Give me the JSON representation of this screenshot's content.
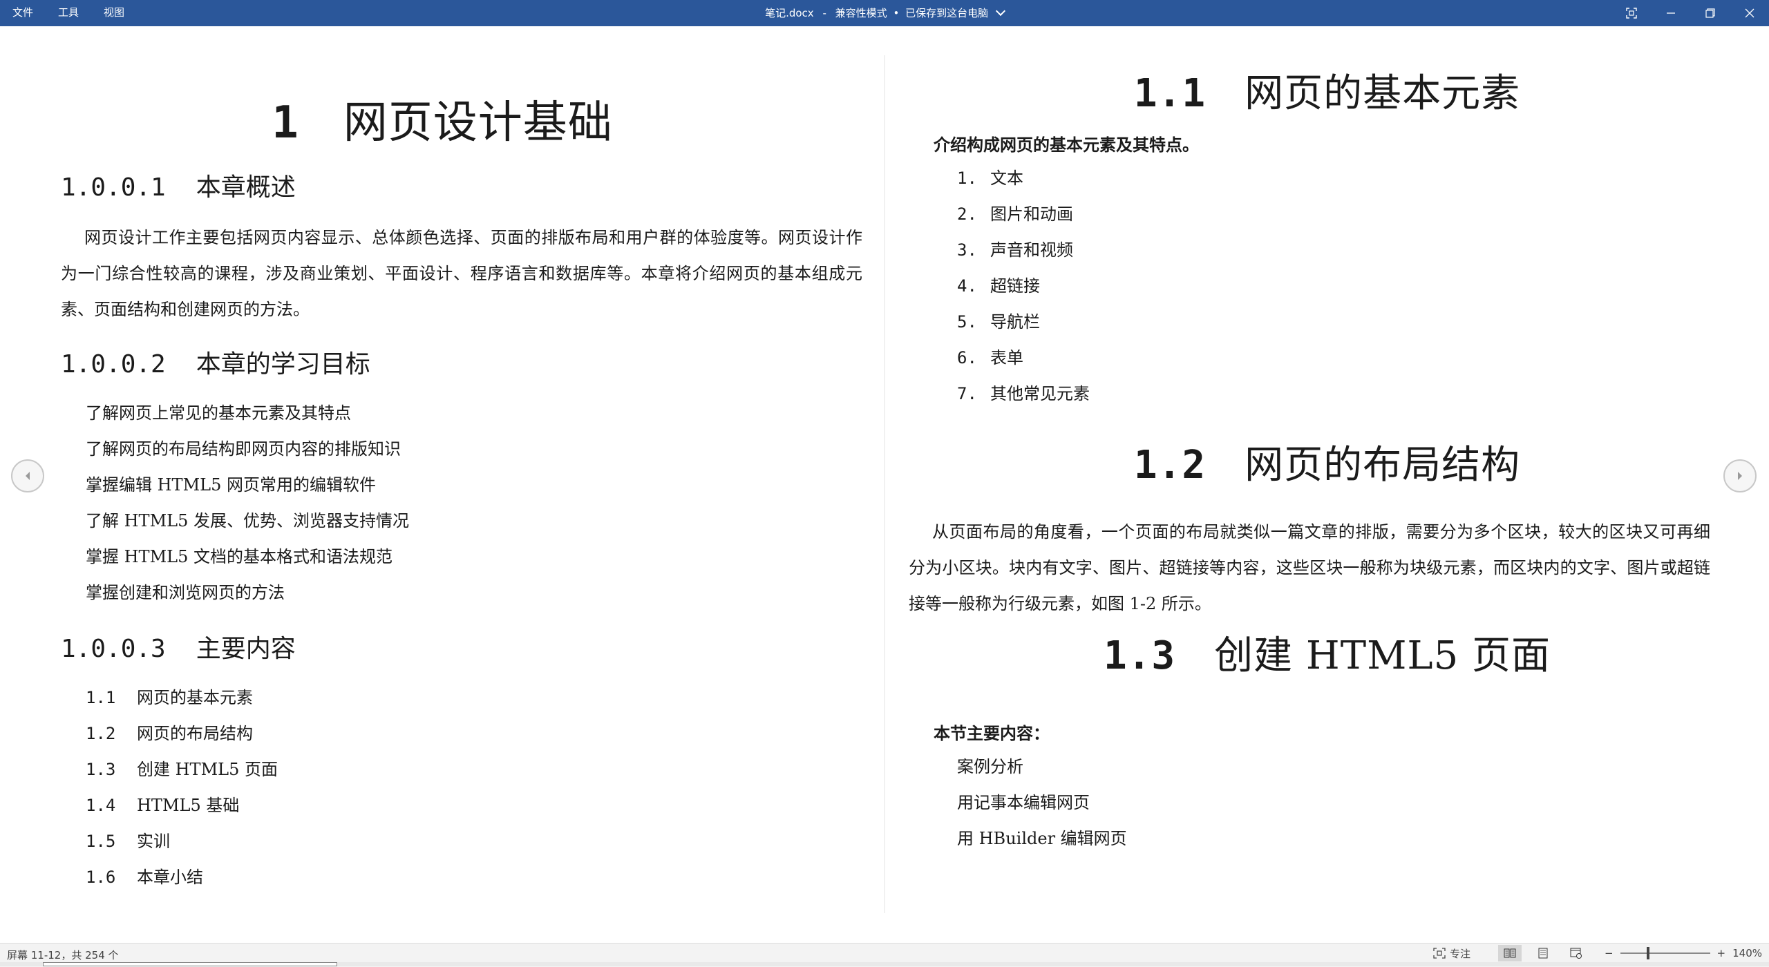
{
  "titlebar": {
    "menu": [
      "文件",
      "工具",
      "视图"
    ],
    "filename": "笔记.docx",
    "separator": "-",
    "mode": "兼容性模式",
    "dot": "•",
    "save_status": "已保存到这台电脑"
  },
  "left_page": {
    "chapter": {
      "num": "1",
      "title": "网页设计基础"
    },
    "sections": [
      {
        "num": "1.0.0.1",
        "title": "本章概述"
      },
      {
        "num": "1.0.0.2",
        "title": "本章的学习目标"
      },
      {
        "num": "1.0.0.3",
        "title": "主要内容"
      }
    ],
    "overview_paragraph": "网页设计工作主要包括网页内容显示、总体颜色选择、页面的排版布局和用户群的体验度等。网页设计作为一门综合性较高的课程，涉及商业策划、平面设计、程序语言和数据库等。本章将介绍网页的基本组成元素、页面结构和创建网页的方法。",
    "goals": [
      "了解网页上常见的基本元素及其特点",
      "了解网页的布局结构即网页内容的排版知识",
      "掌握编辑 HTML5 网页常用的编辑软件",
      "了解 HTML5 发展、优势、浏览器支持情况",
      "掌握 HTML5 文档的基本格式和语法规范",
      "掌握创建和浏览网页的方法"
    ],
    "toc": [
      {
        "num": "1.1",
        "title": "网页的基本元素"
      },
      {
        "num": "1.2",
        "title": "网页的布局结构"
      },
      {
        "num": "1.3",
        "title": "创建 HTML5 页面"
      },
      {
        "num": "1.4",
        "title": "HTML5 基础"
      },
      {
        "num": "1.5",
        "title": "实训"
      },
      {
        "num": "1.6",
        "title": "本章小结"
      }
    ]
  },
  "right_page": {
    "s11": {
      "num": "1.1",
      "title": "网页的基本元素"
    },
    "s11_intro": "介绍构成网页的基本元素及其特点。",
    "s11_items": [
      {
        "num": "1.",
        "text": "文本"
      },
      {
        "num": "2.",
        "text": "图片和动画"
      },
      {
        "num": "3.",
        "text": "声音和视频"
      },
      {
        "num": "4.",
        "text": "超链接"
      },
      {
        "num": "5.",
        "text": "导航栏"
      },
      {
        "num": "6.",
        "text": "表单"
      },
      {
        "num": "7.",
        "text": "其他常见元素"
      }
    ],
    "s12": {
      "num": "1.2",
      "title": "网页的布局结构"
    },
    "s12_paragraph": "从页面布局的角度看，一个页面的布局就类似一篇文章的排版，需要分为多个区块，较大的区块又可再细分为小区块。块内有文字、图片、超链接等内容，这些区块一般称为块级元素，而区块内的文字、图片或超链接等一般称为行级元素，如图 1-2 所示。",
    "s13": {
      "num": "1.3",
      "title": "创建 HTML5 页面"
    },
    "s13_intro": "本节主要内容：",
    "s13_items": [
      "案例分析",
      "用记事本编辑网页",
      "用 HBuilder 编辑网页"
    ]
  },
  "statusbar": {
    "screen_info": "屏幕 11-12，共 254 个",
    "focus_label": "专注",
    "zoom_minus": "−",
    "zoom_plus": "+",
    "zoom_value": "140%"
  },
  "colors": {
    "titlebar": "#2b579a",
    "statusbar": "#f3f3f3"
  }
}
